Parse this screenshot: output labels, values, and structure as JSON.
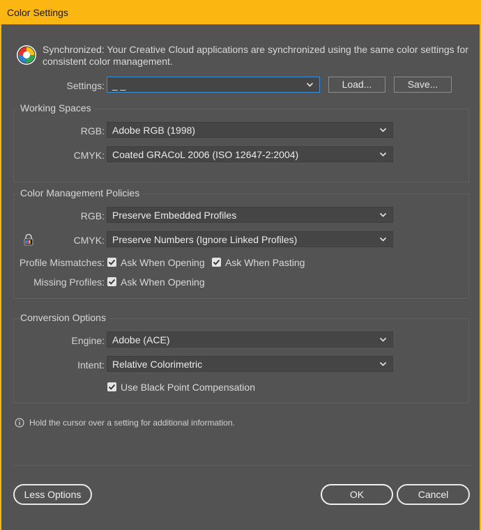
{
  "window": {
    "title": "Color Settings"
  },
  "sync": {
    "message": "Synchronized: Your Creative Cloud applications are synchronized using the same color settings for consistent color management."
  },
  "settings": {
    "label": "Settings:",
    "value": "_ _",
    "load_label": "Load...",
    "save_label": "Save..."
  },
  "working_spaces": {
    "title": "Working Spaces",
    "rgb_label": "RGB:",
    "rgb_value": "Adobe RGB (1998)",
    "cmyk_label": "CMYK:",
    "cmyk_value": "Coated GRACoL 2006 (ISO 12647-2:2004)"
  },
  "policies": {
    "title": "Color Management Policies",
    "rgb_label": "RGB:",
    "rgb_value": "Preserve Embedded Profiles",
    "cmyk_label": "CMYK:",
    "cmyk_value": "Preserve Numbers (Ignore Linked Profiles)",
    "mismatch_label": "Profile Mismatches:",
    "mismatch_open": "Ask When Opening",
    "mismatch_paste": "Ask When Pasting",
    "missing_label": "Missing Profiles:",
    "missing_open": "Ask When Opening"
  },
  "conversion": {
    "title": "Conversion Options",
    "engine_label": "Engine:",
    "engine_value": "Adobe (ACE)",
    "intent_label": "Intent:",
    "intent_value": "Relative Colorimetric",
    "bpc_label": "Use Black Point Compensation"
  },
  "info": {
    "text": "Hold the cursor over a setting for additional information."
  },
  "footer": {
    "less_options": "Less Options",
    "ok": "OK",
    "cancel": "Cancel"
  },
  "colors": {
    "titlebar": "#fbb611",
    "dialog_bg": "#535353",
    "focus": "#3a8fd8"
  }
}
